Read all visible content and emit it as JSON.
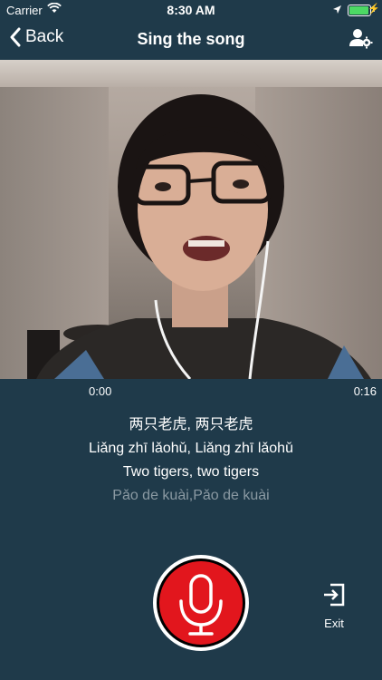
{
  "status_bar": {
    "carrier": "Carrier",
    "time": "8:30 AM",
    "battery_level": 0.95,
    "icons": [
      "wifi-icon",
      "location-icon",
      "battery-icon",
      "charging-icon"
    ]
  },
  "nav": {
    "back_label": "Back",
    "title": "Sing the song",
    "right_icon": "user-settings-icon"
  },
  "player": {
    "current_time": "0:00",
    "duration": "0:16"
  },
  "lyrics": {
    "chinese": "两只老虎, 两只老虎",
    "pinyin": "Liǎng zhī lǎohǔ, Liǎng zhī lǎohǔ",
    "english": "Two tigers, two tigers",
    "next_line": "Pǎo de kuài,Pǎo de kuài"
  },
  "controls": {
    "record_icon": "microphone-icon",
    "exit_label": "Exit",
    "exit_icon": "exit-icon"
  },
  "colors": {
    "background": "#1f3a4a",
    "record_button": "#e2161d",
    "dim_text": "#8a99a2"
  }
}
